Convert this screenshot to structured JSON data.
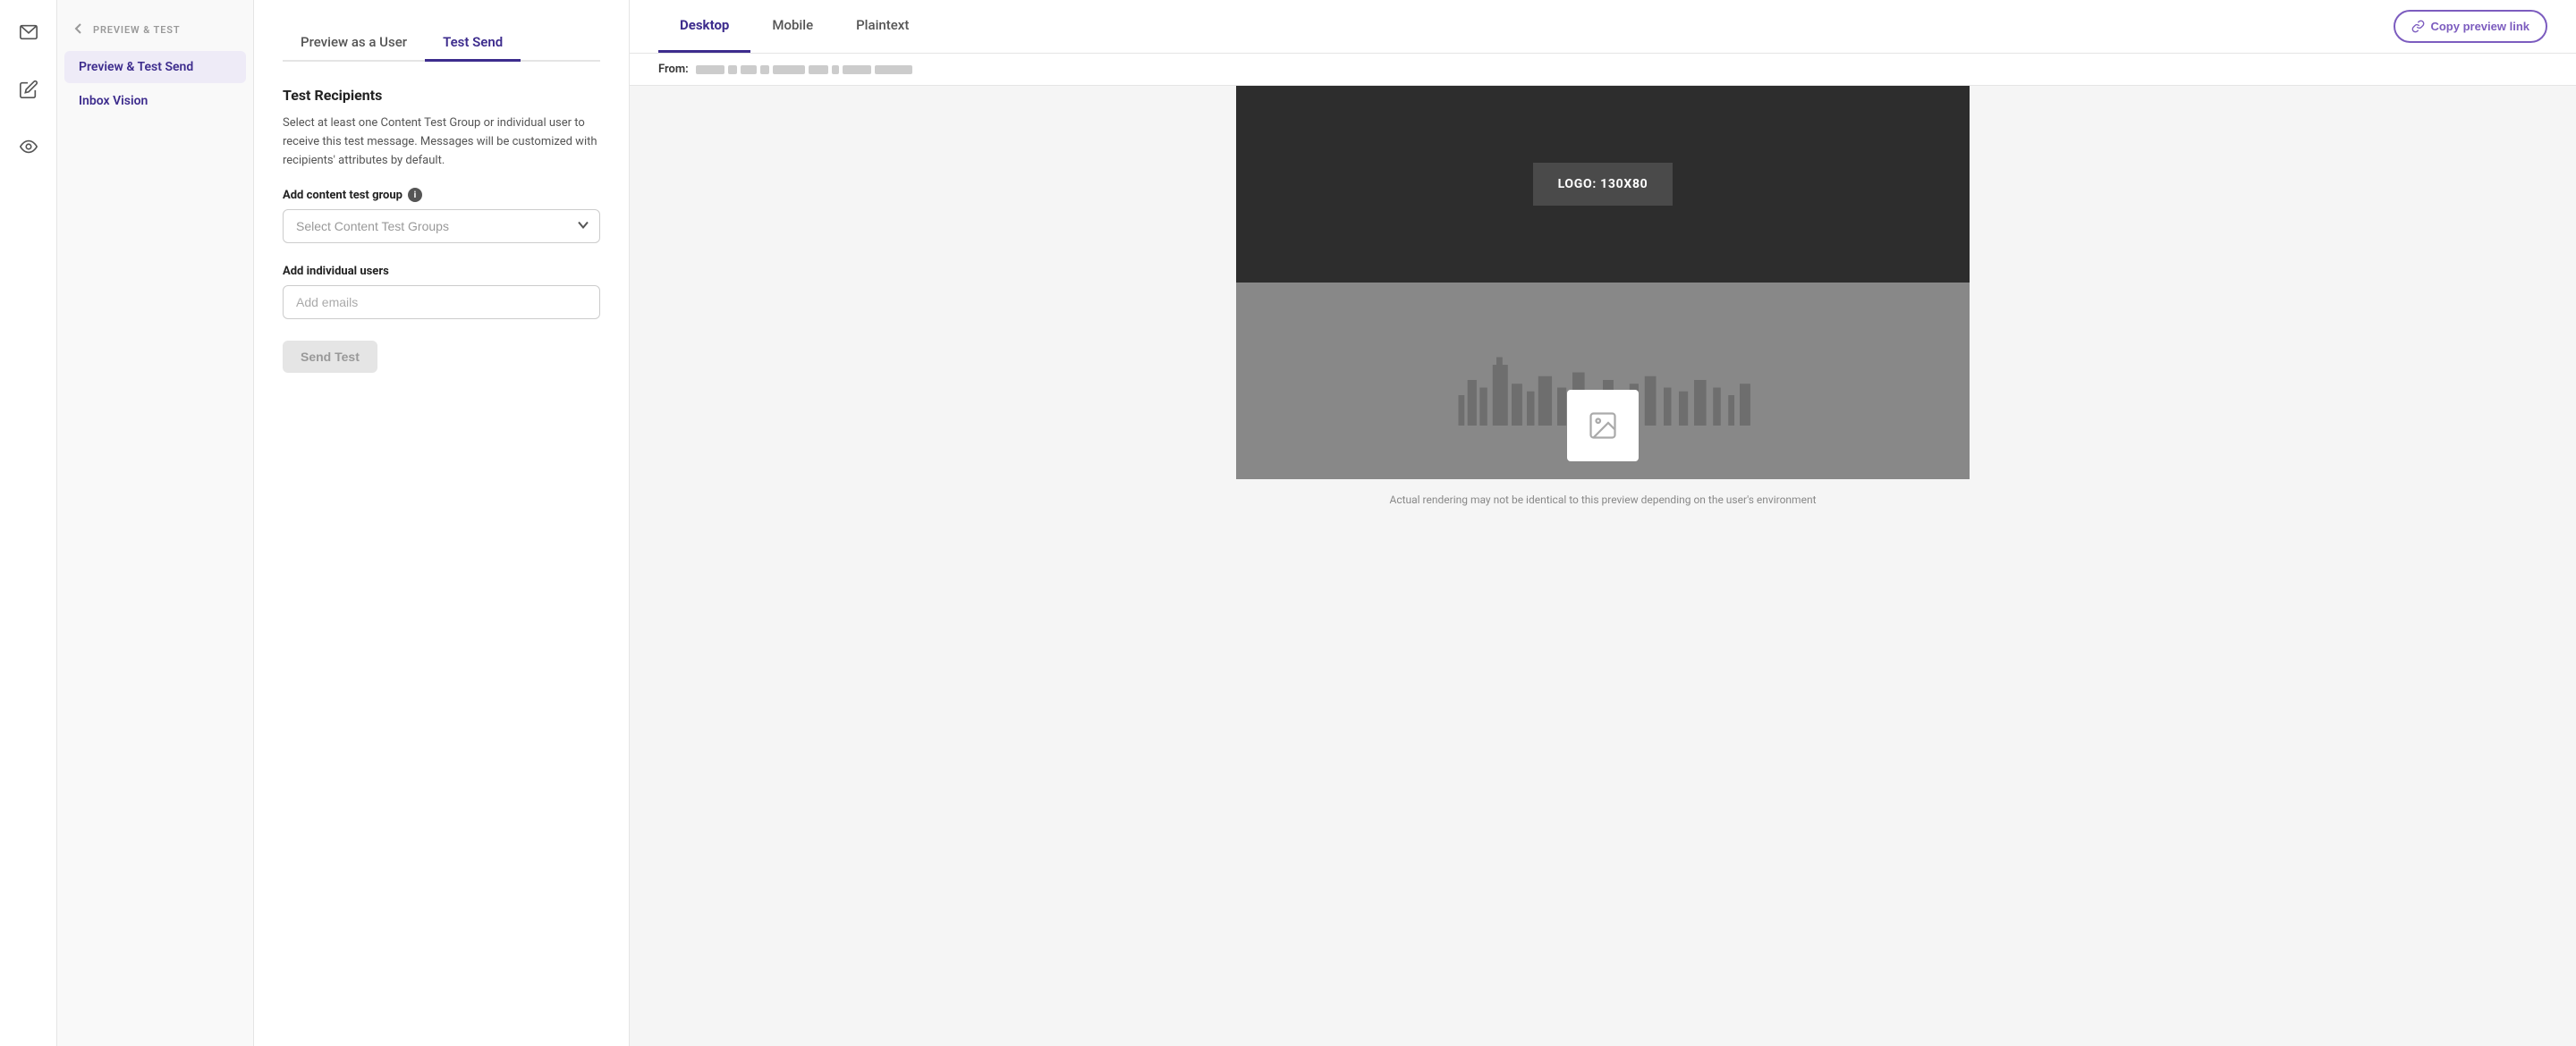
{
  "sidebar": {
    "items": [
      {
        "name": "email-icon",
        "label": "Email"
      },
      {
        "name": "compose-icon",
        "label": "Compose"
      },
      {
        "name": "eye-icon",
        "label": "Preview"
      }
    ]
  },
  "left_nav": {
    "header": "Preview & Test",
    "back_label": "←",
    "items": [
      {
        "id": "preview-test-send",
        "label": "Preview & Test Send",
        "active": true
      },
      {
        "id": "inbox-vision",
        "label": "Inbox Vision",
        "active": false
      }
    ]
  },
  "form": {
    "tabs": [
      {
        "id": "preview-as-user",
        "label": "Preview as a User",
        "active": false
      },
      {
        "id": "test-send",
        "label": "Test Send",
        "active": true
      }
    ],
    "section_title": "Test Recipients",
    "section_desc": "Select at least one Content Test Group or individual user to receive this test message. Messages will be customized with recipients' attributes by default.",
    "content_test_group_label": "Add content test group",
    "content_test_group_placeholder": "Select Content Test Groups",
    "individual_users_label": "Add individual users",
    "individual_users_placeholder": "Add emails",
    "send_btn_label": "Send Test"
  },
  "preview": {
    "header_tabs": [
      {
        "id": "desktop",
        "label": "Desktop",
        "active": true
      },
      {
        "id": "mobile",
        "label": "Mobile",
        "active": false
      },
      {
        "id": "plaintext",
        "label": "Plaintext",
        "active": false
      }
    ],
    "copy_link_btn": "Copy preview link",
    "from_label": "From:",
    "logo_placeholder": "LOGO: 130X80",
    "footer_note": "Actual rendering may not be identical to this preview depending on the user's environment"
  }
}
